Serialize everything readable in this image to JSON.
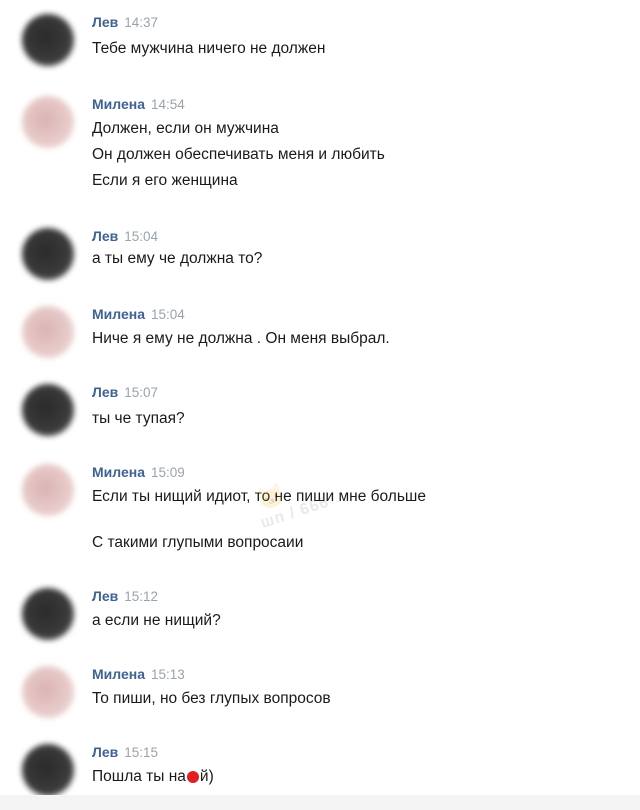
{
  "messages": [
    {
      "author": "Лев",
      "time": "14:37",
      "lines": [
        "Тебе мужчина ничего не должен"
      ]
    },
    {
      "author": "Милена",
      "time": "14:54",
      "lines": [
        "Должен, если он мужчина",
        "Он должен обеспечивать меня и любить",
        "Если я его женщина"
      ]
    },
    {
      "author": "Лев",
      "time": "15:04",
      "lines": [
        "а ты ему че должна то?"
      ]
    },
    {
      "author": "Милена",
      "time": "15:04",
      "lines": [
        "Ниче я ему не должна . Он меня выбрал."
      ]
    },
    {
      "author": "Лев",
      "time": "15:07",
      "lines": [
        "ты че тупая?"
      ]
    },
    {
      "author": "Милена",
      "time": "15:09",
      "lines": [
        "Если ты нищий идиот, то не пиши мне больше",
        "С такими глупыми вопросаии"
      ]
    },
    {
      "author": "Лев",
      "time": "15:12",
      "lines": [
        "а если не нищий?"
      ]
    },
    {
      "author": "Милена",
      "time": "15:13",
      "lines": [
        "То пиши, но без глупых вопросов"
      ]
    },
    {
      "author": "Лев",
      "time": "15:15",
      "lines": [
        "Пошла ты на",
        "й)"
      ]
    }
  ],
  "watermark": {
    "text": "шп / 666",
    "icon": "cat-icon"
  },
  "colors": {
    "author": "#3f6293",
    "time": "#9aa3ad",
    "text": "#1a1a1a",
    "emoji": "#e02020"
  }
}
